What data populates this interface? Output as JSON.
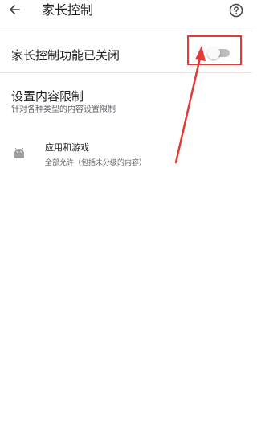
{
  "header": {
    "title": "家长控制",
    "back_icon": "arrow-left-icon",
    "help_icon": "help-circle-icon"
  },
  "toggle": {
    "label": "家长控制功能已关闭",
    "state": "off"
  },
  "section": {
    "title": "设置内容限制",
    "subtitle": "针对各种类型的内容设置限制"
  },
  "apps": {
    "title": "应用和游戏",
    "subtitle": "全部允许（包括未分级的内容）",
    "icon": "android-icon"
  },
  "colors": {
    "annotation": "#e53935",
    "switch_track": "#bdbdbd",
    "switch_thumb": "#fafafa",
    "text_primary": "#202124",
    "text_secondary": "#5f6368",
    "divider": "#e8e8e8"
  }
}
